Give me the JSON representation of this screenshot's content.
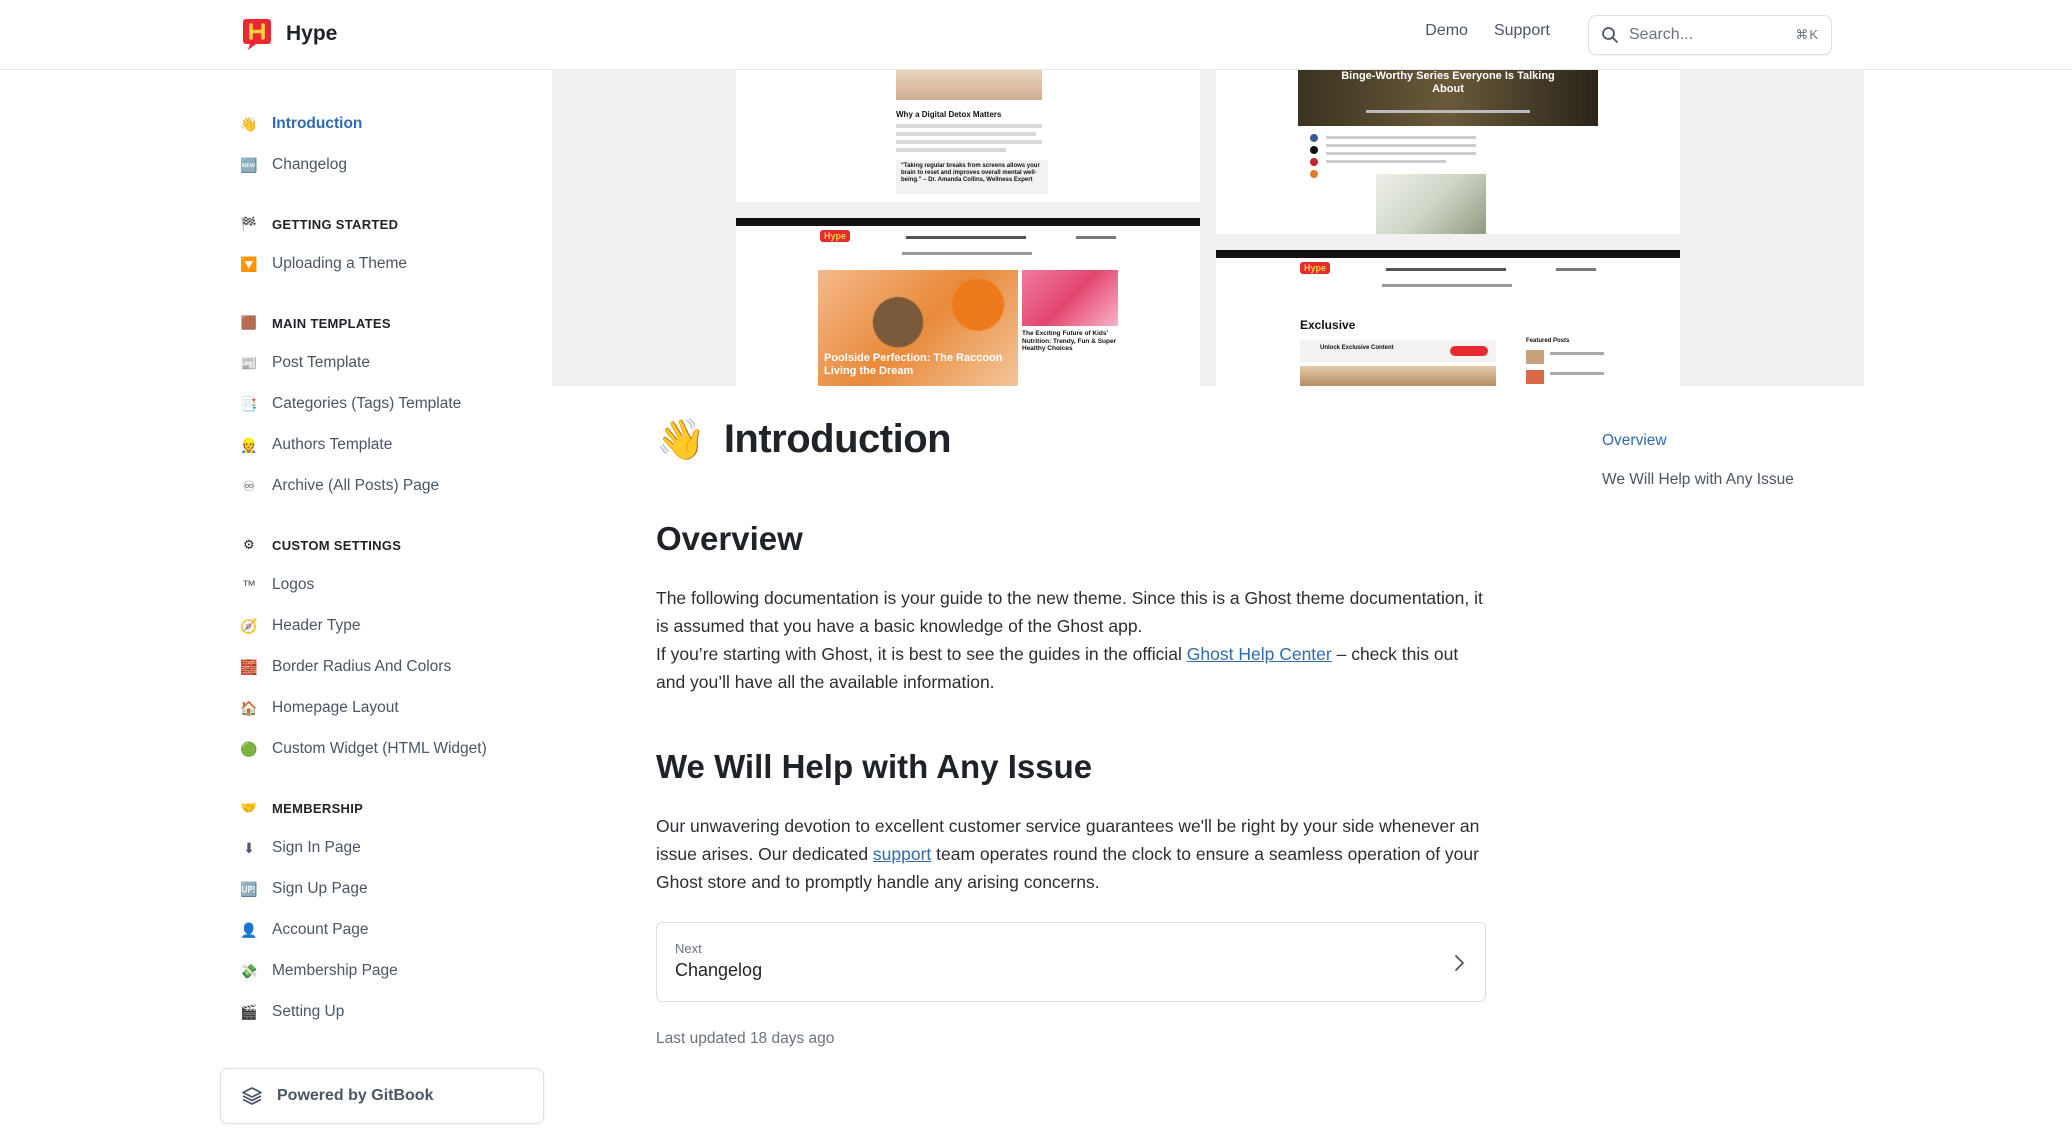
{
  "header": {
    "brand_name": "Hype",
    "brand_logo_letter": "H",
    "brand_color": "#e8292f",
    "links": [
      "Demo",
      "Support"
    ],
    "search_placeholder": "Search...",
    "search_shortcut": "⌘K"
  },
  "sidebar": {
    "top_items": [
      {
        "icon": "👋",
        "label": "Introduction",
        "active": true
      },
      {
        "icon": "🆕",
        "label": "Changelog",
        "active": false
      }
    ],
    "sections": [
      {
        "icon": "🏁",
        "title": "GETTING STARTED",
        "items": [
          {
            "icon": "🔽",
            "label": "Uploading a Theme"
          }
        ]
      },
      {
        "icon": "🟫",
        "title": "MAIN TEMPLATES",
        "items": [
          {
            "icon": "📰",
            "label": "Post Template"
          },
          {
            "icon": "📑",
            "label": "Categories (Tags) Template"
          },
          {
            "icon": "👷",
            "label": "Authors Template"
          },
          {
            "icon": "♾",
            "label": "Archive (All Posts) Page"
          }
        ]
      },
      {
        "icon": "⚙",
        "title": "CUSTOM SETTINGS",
        "items": [
          {
            "icon": "™",
            "label": "Logos"
          },
          {
            "icon": "🧭",
            "label": "Header Type"
          },
          {
            "icon": "🧱",
            "label": "Border Radius And Colors"
          },
          {
            "icon": "🏠",
            "label": "Homepage Layout"
          },
          {
            "icon": "🟢",
            "label": "Custom Widget (HTML Widget)"
          }
        ]
      },
      {
        "icon": "🤝",
        "title": "MEMBERSHIP",
        "items": [
          {
            "icon": "⬇",
            "label": "Sign In Page"
          },
          {
            "icon": "🆙",
            "label": "Sign Up Page"
          },
          {
            "icon": "👤",
            "label": "Account Page"
          },
          {
            "icon": "💸",
            "label": "Membership Page"
          },
          {
            "icon": "🎬",
            "label": "Setting Up"
          }
        ]
      }
    ],
    "powered_by": "Powered by GitBook"
  },
  "hero": {
    "shot_a": {
      "title": "Why a Digital Detox Matters",
      "quote": "\"Taking regular breaks from screens allows your brain to reset and improves overall mental well-being.\" – Dr. Amanda Collins, Wellness Expert"
    },
    "shot_b": {
      "headline": "Binge-Worthy Series Everyone Is Talking About"
    },
    "shot_c": {
      "logo": "Hype",
      "feature": "Poolside Perfection: The Raccoon Living the Dream",
      "side": "The Exciting Future of Kids' Nutrition: Trendy, Fun & Super Healthy Choices"
    },
    "shot_d": {
      "logo": "Hype",
      "section": "Exclusive",
      "badge": "Unlock Exclusive Content",
      "side": "Featured Posts"
    }
  },
  "page": {
    "emoji": "👋",
    "title": "Introduction",
    "overview_heading": "Overview",
    "overview_p1": "The following documentation is your guide to the new theme. Since this is a Ghost theme documentation, it is assumed that you have a basic knowledge of the Ghost app.",
    "overview_p2_before": "If you’re starting with Ghost, it is best to see the guides in the official ",
    "overview_p2_link": "Ghost Help Center",
    "overview_p2_after": " – check this out and you’ll have all the available information.",
    "help_heading": "We Will Help with Any Issue",
    "help_p_before": "Our unwavering devotion to excellent customer service guarantees we'll be right by your side whenever an issue arises. Our dedicated ",
    "help_p_link": "support",
    "help_p_after": " team operates round the clock to ensure a seamless operation of your Ghost store and to promptly handle any arising concerns.",
    "next_label": "Next",
    "next_title": "Changelog",
    "last_updated": "Last updated 18 days ago"
  },
  "toc": {
    "items": [
      {
        "label": "Overview",
        "active": true
      },
      {
        "label": "We Will Help with Any Issue",
        "active": false
      }
    ]
  }
}
